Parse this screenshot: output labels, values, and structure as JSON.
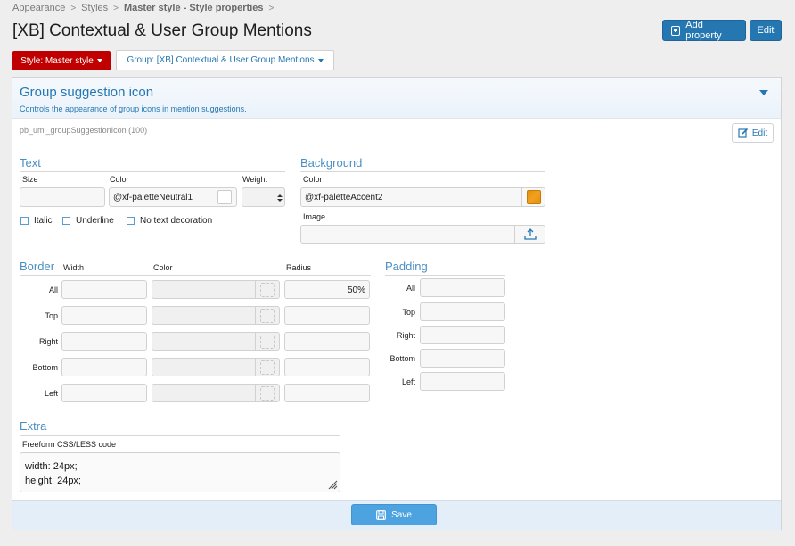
{
  "breadcrumb": {
    "items": [
      "Appearance",
      "Styles",
      "Master style - Style properties"
    ],
    "separator": ">"
  },
  "page": {
    "title": "[XB] Contextual & User Group Mentions"
  },
  "header_buttons": {
    "add_property": "Add property",
    "edit": "Edit"
  },
  "filters": {
    "style": "Style: Master style",
    "group": "Group: [XB] Contextual & User Group Mentions"
  },
  "property": {
    "title": "Group suggestion icon",
    "description": "Controls the appearance of group icons in mention suggestions.",
    "id": "pb_umi_groupSuggestionIcon (100)",
    "edit_label": "Edit"
  },
  "text_section": {
    "title": "Text",
    "size_label": "Size",
    "size_value": "",
    "color_label": "Color",
    "color_value": "@xf-paletteNeutral1",
    "weight_label": "Weight",
    "options": [
      {
        "label": "Italic",
        "checked": false
      },
      {
        "label": "Underline",
        "checked": false
      },
      {
        "label": "No text decoration",
        "checked": false
      }
    ]
  },
  "background_section": {
    "title": "Background",
    "color_label": "Color",
    "color_value": "@xf-paletteAccent2",
    "swatch_color": "#e8900c",
    "image_label": "Image",
    "image_value": ""
  },
  "border_section": {
    "title": "Border",
    "width_label": "Width",
    "color_label": "Color",
    "radius_label": "Radius",
    "rows": [
      {
        "label": "All",
        "width": "",
        "color": "",
        "radius": "50%"
      },
      {
        "label": "Top",
        "width": "",
        "color": "",
        "radius": ""
      },
      {
        "label": "Right",
        "width": "",
        "color": "",
        "radius": ""
      },
      {
        "label": "Bottom",
        "width": "",
        "color": "",
        "radius": ""
      },
      {
        "label": "Left",
        "width": "",
        "color": "",
        "radius": ""
      }
    ]
  },
  "padding_section": {
    "title": "Padding",
    "rows": [
      {
        "label": "All",
        "value": ""
      },
      {
        "label": "Top",
        "value": ""
      },
      {
        "label": "Right",
        "value": ""
      },
      {
        "label": "Bottom",
        "value": ""
      },
      {
        "label": "Left",
        "value": ""
      }
    ]
  },
  "extra_section": {
    "title": "Extra",
    "code_label": "Freeform CSS/LESS code",
    "code_value": "width: 24px;\nheight: 24px;"
  },
  "footer": {
    "save_label": "Save"
  },
  "colors": {
    "accent": "#2577b1",
    "style_button": "#c00000",
    "save_button": "#4da3e0"
  }
}
